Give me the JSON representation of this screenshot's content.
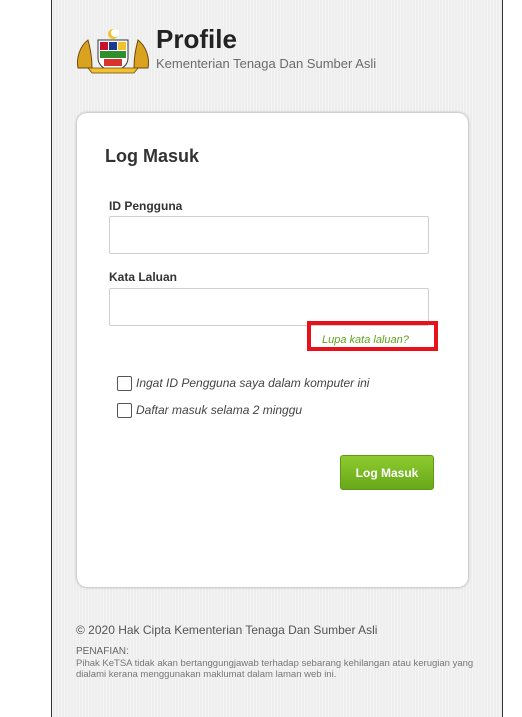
{
  "header": {
    "title": "Profile",
    "subtitle": "Kementerian Tenaga Dan Sumber Asli",
    "logo_icon": "coat-of-arms-icon"
  },
  "login_card": {
    "title": "Log Masuk",
    "username_label": "ID Pengguna",
    "username_value": "",
    "password_label": "Kata Laluan",
    "password_value": "",
    "forgot_link": "Lupa kata laluan?",
    "remember_id_label": "Ingat ID Pengguna saya dalam komputer ini",
    "remember_id_checked": false,
    "stay_signed_in_label": "Daftar masuk selama 2 minggu",
    "stay_signed_in_checked": false,
    "submit_label": "Log Masuk"
  },
  "footer": {
    "copyright": "© 2020 Hak Cipta Kementerian Tenaga Dan Sumber Asli",
    "disclaimer_title": "PENAFIAN:",
    "disclaimer_text": "Pihak KeTSA tidak akan bertanggungjawab terhadap sebarang kehilangan atau kerugian yang dialami kerana menggunakan maklumat dalam laman web ini."
  },
  "colors": {
    "accent_green": "#6aaa1c",
    "highlight_red": "#e8101a"
  }
}
